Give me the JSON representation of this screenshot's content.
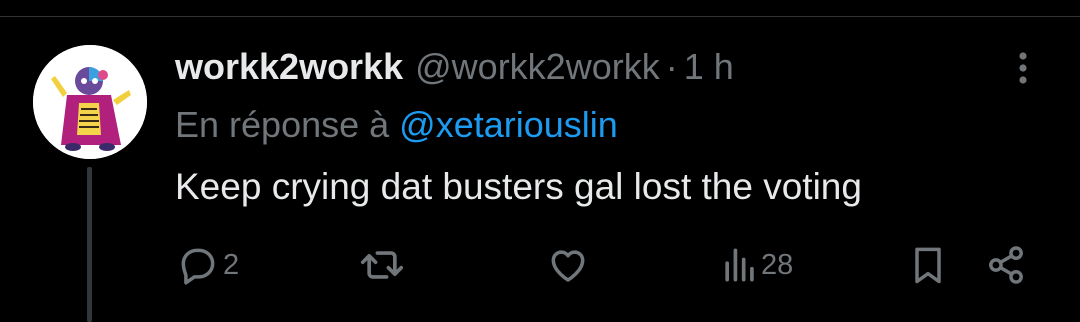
{
  "tweet": {
    "display_name": "workk2workk",
    "handle": "@workk2workk",
    "separator": "·",
    "time": "1 h",
    "reply_prefix": "En réponse à",
    "reply_mention": "@xetariouslin",
    "text": "Keep crying dat busters gal lost the voting"
  },
  "actions": {
    "reply": {
      "icon": "reply-icon",
      "count": "2"
    },
    "retweet": {
      "icon": "retweet-icon"
    },
    "like": {
      "icon": "heart-icon"
    },
    "views": {
      "icon": "views-icon",
      "count": "28"
    },
    "bookmark": {
      "icon": "bookmark-icon"
    },
    "share": {
      "icon": "share-icon"
    }
  },
  "colors": {
    "background": "#000000",
    "primary_text": "#e7e9ea",
    "secondary_text": "#71767b",
    "mention": "#1d9bf0",
    "thread_line": "#333639"
  }
}
